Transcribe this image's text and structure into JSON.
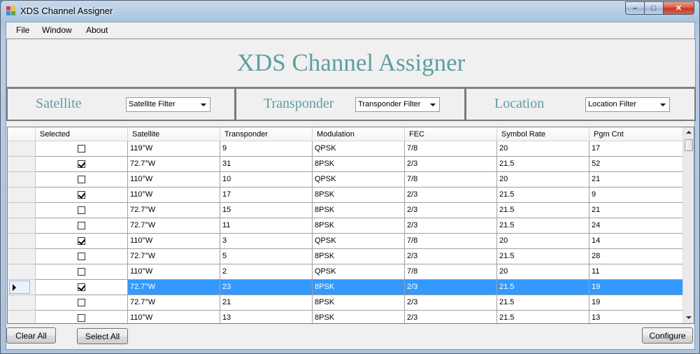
{
  "window": {
    "title": "XDS Channel Assigner",
    "caption": {
      "minimize": "–",
      "maximize": "□",
      "close": "✕"
    }
  },
  "menu": {
    "items": [
      "File",
      "Window",
      "About"
    ]
  },
  "banner": {
    "title": "XDS Channel Assigner"
  },
  "filters": [
    {
      "label": "Satellite",
      "value": "Satellite Filter"
    },
    {
      "label": "Transponder",
      "value": "Transponder Filter"
    },
    {
      "label": "Location",
      "value": "Location Filter"
    }
  ],
  "grid": {
    "columns": [
      "Selected",
      "Satellite",
      "Transponder",
      "Modulation",
      "FEC",
      "Symbol Rate",
      "Pgm Cnt"
    ],
    "selected_row_index": 9,
    "rows": [
      {
        "selected": false,
        "satellite": "119°W",
        "transponder": "9",
        "modulation": "QPSK",
        "fec": "7/8",
        "symbol_rate": "20",
        "pgm_cnt": "17"
      },
      {
        "selected": true,
        "satellite": "72.7°W",
        "transponder": "31",
        "modulation": "8PSK",
        "fec": "2/3",
        "symbol_rate": "21.5",
        "pgm_cnt": "52"
      },
      {
        "selected": false,
        "satellite": "110°W",
        "transponder": "10",
        "modulation": "QPSK",
        "fec": "7/8",
        "symbol_rate": "20",
        "pgm_cnt": "21"
      },
      {
        "selected": true,
        "satellite": "110°W",
        "transponder": "17",
        "modulation": "8PSK",
        "fec": "2/3",
        "symbol_rate": "21.5",
        "pgm_cnt": "9"
      },
      {
        "selected": false,
        "satellite": "72.7°W",
        "transponder": "15",
        "modulation": "8PSK",
        "fec": "2/3",
        "symbol_rate": "21.5",
        "pgm_cnt": "21"
      },
      {
        "selected": false,
        "satellite": "72.7°W",
        "transponder": "11",
        "modulation": "8PSK",
        "fec": "2/3",
        "symbol_rate": "21.5",
        "pgm_cnt": "24"
      },
      {
        "selected": true,
        "satellite": "110°W",
        "transponder": "3",
        "modulation": "QPSK",
        "fec": "7/8",
        "symbol_rate": "20",
        "pgm_cnt": "14"
      },
      {
        "selected": false,
        "satellite": "72.7°W",
        "transponder": "5",
        "modulation": "8PSK",
        "fec": "2/3",
        "symbol_rate": "21.5",
        "pgm_cnt": "28"
      },
      {
        "selected": false,
        "satellite": "110°W",
        "transponder": "2",
        "modulation": "QPSK",
        "fec": "7/8",
        "symbol_rate": "20",
        "pgm_cnt": "11"
      },
      {
        "selected": true,
        "satellite": "72.7°W",
        "transponder": "23",
        "modulation": "8PSK",
        "fec": "2/3",
        "symbol_rate": "21.5",
        "pgm_cnt": "19"
      },
      {
        "selected": false,
        "satellite": "72.7°W",
        "transponder": "21",
        "modulation": "8PSK",
        "fec": "2/3",
        "symbol_rate": "21.5",
        "pgm_cnt": "19"
      },
      {
        "selected": false,
        "satellite": "110°W",
        "transponder": "13",
        "modulation": "8PSK",
        "fec": "2/3",
        "symbol_rate": "21.5",
        "pgm_cnt": "13"
      }
    ]
  },
  "buttons": {
    "clear_all": "Clear All",
    "select_all": "Select All",
    "configure": "Configure"
  },
  "colors": {
    "accent_text": "#5f9ea0",
    "selection": "#3399ff"
  }
}
